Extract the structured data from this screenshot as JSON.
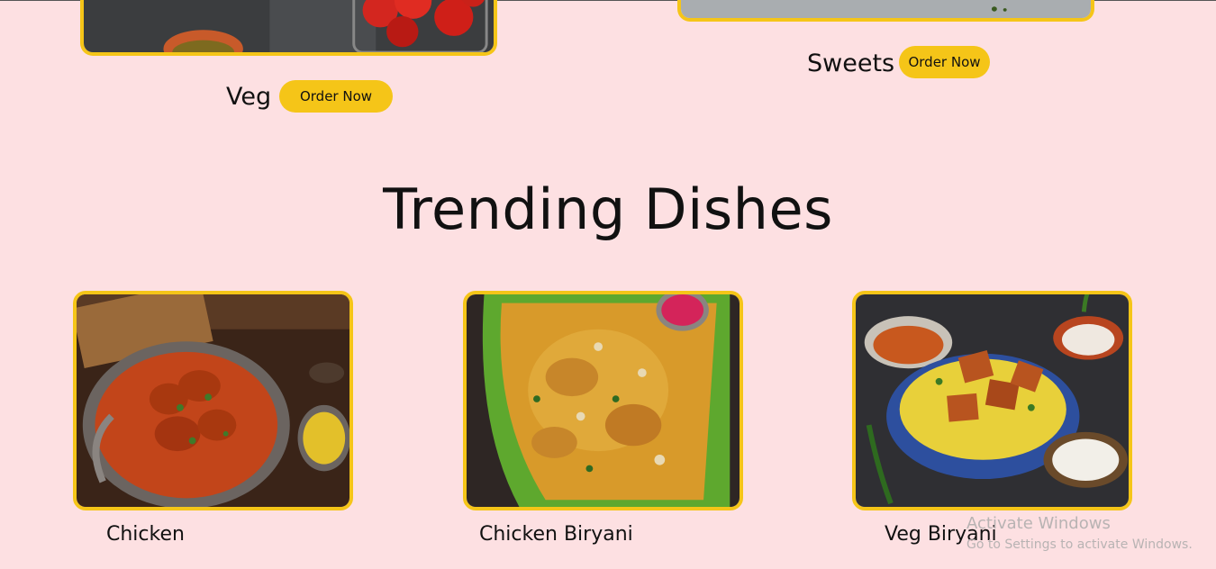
{
  "categories": [
    {
      "label": "Veg",
      "button": "Order Now"
    },
    {
      "label": "Sweets",
      "button": "Order Now"
    }
  ],
  "trending": {
    "title": "Trending Dishes",
    "dishes": [
      {
        "name": "Chicken"
      },
      {
        "name": "Chicken Biryani"
      },
      {
        "name": "Veg Biryani"
      }
    ]
  },
  "watermark": {
    "title": "Activate Windows",
    "subtitle": "Go to Settings to activate Windows."
  },
  "colors": {
    "background": "#fde0e2",
    "accent": "#f5c518"
  }
}
